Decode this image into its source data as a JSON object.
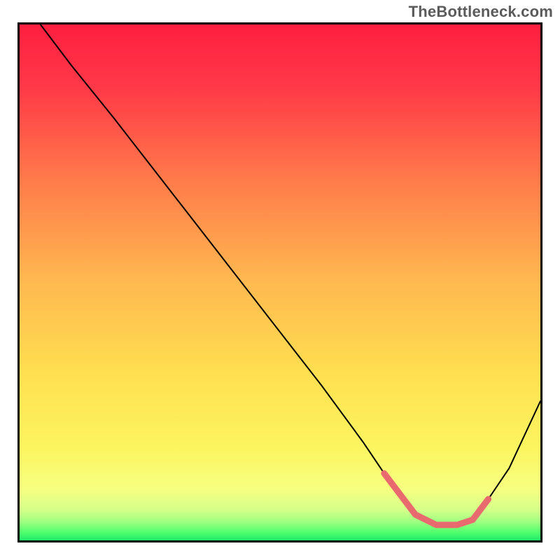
{
  "attribution": "TheBottleneck.com",
  "chart_data": {
    "type": "line",
    "title": "",
    "xlabel": "",
    "ylabel": "",
    "xlim": [
      0,
      100
    ],
    "ylim": [
      0,
      100
    ],
    "grid": false,
    "legend": false,
    "annotations": [],
    "background": {
      "type": "gradient",
      "description": "Vertical red→orange→yellow→green gradient with narrow bright-green band at bottom",
      "stops": [
        {
          "t": 0.0,
          "color": "#ff1f3f"
        },
        {
          "t": 0.12,
          "color": "#ff3848"
        },
        {
          "t": 0.3,
          "color": "#ff7a4a"
        },
        {
          "t": 0.5,
          "color": "#ffb950"
        },
        {
          "t": 0.68,
          "color": "#ffe050"
        },
        {
          "t": 0.82,
          "color": "#fcf560"
        },
        {
          "t": 0.9,
          "color": "#f7ff80"
        },
        {
          "t": 0.94,
          "color": "#d6ff8a"
        },
        {
          "t": 0.965,
          "color": "#9cff80"
        },
        {
          "t": 0.985,
          "color": "#4eff6d"
        },
        {
          "t": 1.0,
          "color": "#20e86a"
        }
      ]
    },
    "series": [
      {
        "name": "bottleneck-curve",
        "stroke": "#000000",
        "stroke_width": 2,
        "x": [
          4,
          10,
          18,
          28,
          38,
          48,
          58,
          66,
          70,
          73,
          76,
          80,
          84,
          87,
          90,
          94,
          100
        ],
        "y": [
          100,
          92,
          82,
          69,
          56,
          43,
          30,
          19,
          13,
          9,
          5,
          3,
          3,
          4,
          8,
          14,
          27
        ]
      }
    ],
    "overlays": [
      {
        "name": "optimal-zone-marker",
        "type": "line",
        "stroke": "#e86a6f",
        "stroke_width": 9,
        "linecap": "round",
        "x": [
          70,
          73,
          76,
          80,
          84,
          87,
          90
        ],
        "y": [
          13,
          9,
          5,
          3,
          3,
          4,
          8
        ]
      }
    ]
  }
}
